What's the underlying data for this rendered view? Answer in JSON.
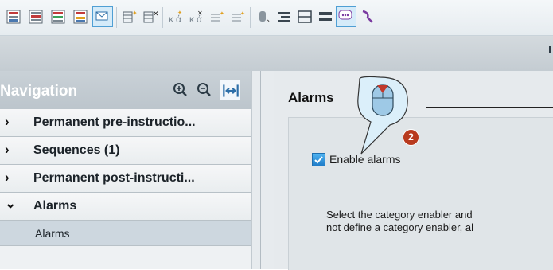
{
  "toolbar": {
    "icons": [
      "layout-icon-1",
      "layout-icon-2",
      "layout-icon-3",
      "layout-icon-4",
      "message-icon",
      "insert-row-icon",
      "delete-row-icon",
      "insert-column-icon",
      "delete-column-icon",
      "format-icon-1",
      "format-icon-2",
      "cylinder-icon",
      "align-icon",
      "table-icon",
      "list-icon",
      "comment-icon",
      "tool-icon"
    ],
    "active_index": 4
  },
  "navigation": {
    "title": "Navigation",
    "items": [
      {
        "label": "Permanent pre-instructio...",
        "expanded": false
      },
      {
        "label": "Sequences (1)",
        "expanded": false
      },
      {
        "label": "Permanent post-instructi...",
        "expanded": false
      },
      {
        "label": "Alarms",
        "expanded": true
      }
    ],
    "child": {
      "label": "Alarms"
    }
  },
  "content": {
    "title": "Alarms",
    "enable_alarms_label": "Enable alarms",
    "enable_alarms_checked": true,
    "description_line1": "Select the category enabler and",
    "description_line2": "not define a category enabler, al"
  },
  "callout": {
    "step": "2"
  },
  "colors": {
    "accent": "#2a84c8",
    "step_badge": "#b83a1e"
  }
}
